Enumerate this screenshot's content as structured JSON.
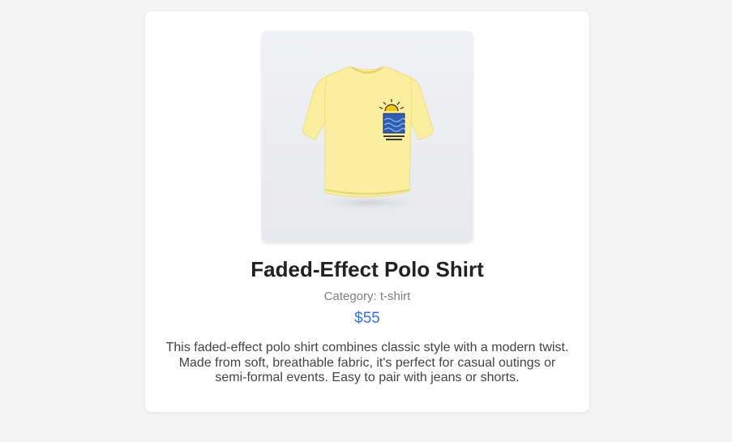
{
  "product": {
    "image_alt": "Yellow t-shirt with sun and waves print",
    "title": "Faded-Effect Polo Shirt",
    "category": "Category: t-shirt",
    "price": "$55",
    "description": "This faded-effect polo shirt combines classic style with a modern twist. Made from soft, breathable fabric, it's perfect for casual outings or semi-formal events. Easy to pair with jeans or shorts."
  },
  "colors": {
    "page_background": "#f4f4f4",
    "card_background": "#ffffff",
    "price": "#3b73db",
    "shirt": "#fbef9f"
  }
}
